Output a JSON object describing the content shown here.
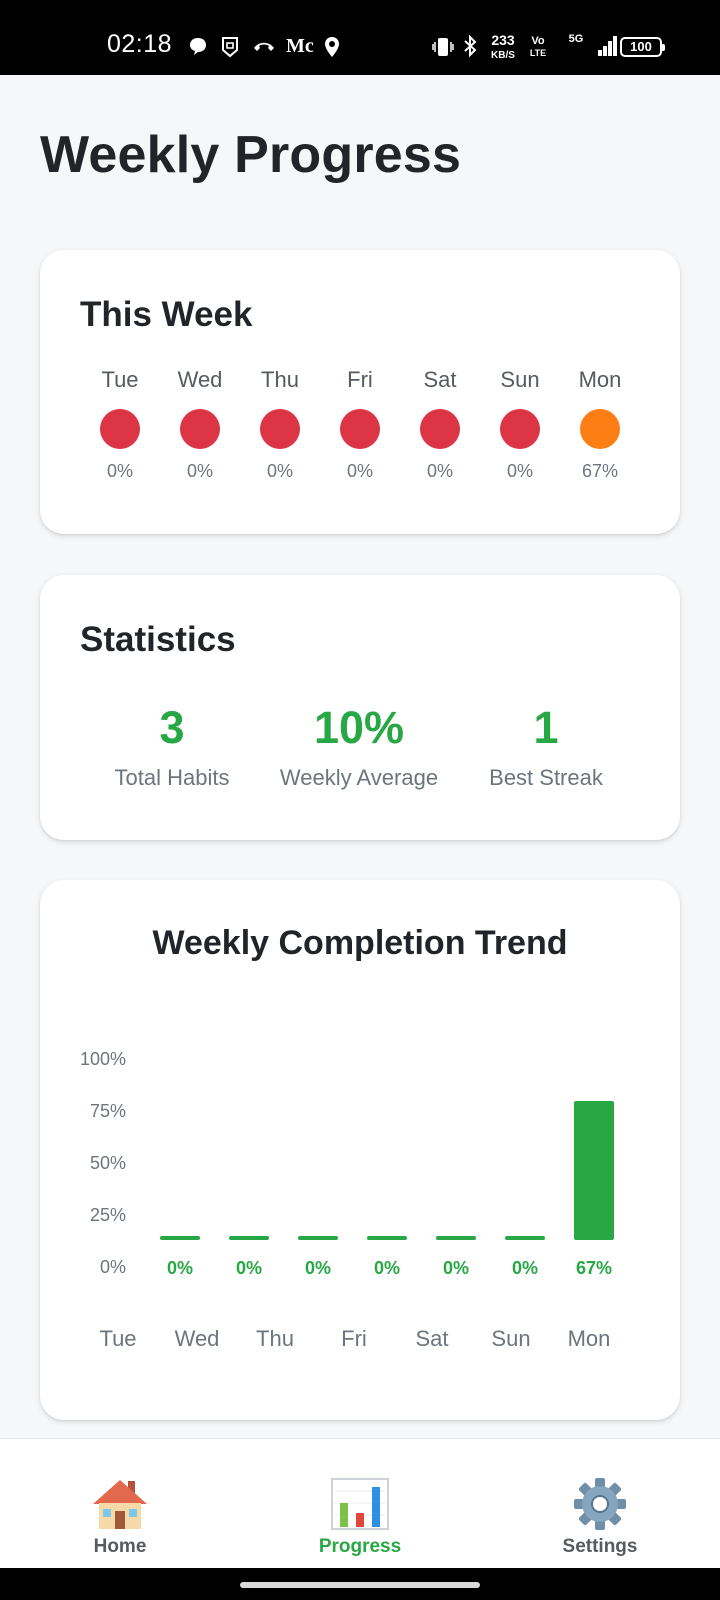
{
  "status_bar": {
    "time": "02:18",
    "network_speed_value": "233",
    "network_speed_unit": "KB/S",
    "volte_top": "Vo",
    "volte_bottom": "LTE",
    "network_type": "5G",
    "battery": "100",
    "carrier_text": "Mc"
  },
  "page": {
    "title": "Weekly Progress"
  },
  "this_week": {
    "title": "This Week",
    "days": [
      {
        "name": "Tue",
        "percent": "0%",
        "color": "#dc3545"
      },
      {
        "name": "Wed",
        "percent": "0%",
        "color": "#dc3545"
      },
      {
        "name": "Thu",
        "percent": "0%",
        "color": "#dc3545"
      },
      {
        "name": "Fri",
        "percent": "0%",
        "color": "#dc3545"
      },
      {
        "name": "Sat",
        "percent": "0%",
        "color": "#dc3545"
      },
      {
        "name": "Sun",
        "percent": "0%",
        "color": "#dc3545"
      },
      {
        "name": "Mon",
        "percent": "67%",
        "color": "#fd7e14"
      }
    ]
  },
  "statistics": {
    "title": "Statistics",
    "items": [
      {
        "value": "3",
        "label": "Total Habits"
      },
      {
        "value": "10%",
        "label": "Weekly Average"
      },
      {
        "value": "1",
        "label": "Best Streak"
      }
    ]
  },
  "chart_data": {
    "type": "bar",
    "title": "Weekly Completion Trend",
    "categories": [
      "Tue",
      "Wed",
      "Thu",
      "Fri",
      "Sat",
      "Sun",
      "Mon"
    ],
    "values": [
      0,
      0,
      0,
      0,
      0,
      0,
      67
    ],
    "data_labels": [
      "0%",
      "0%",
      "0%",
      "0%",
      "0%",
      "0%",
      "67%"
    ],
    "y_ticks": [
      "100%",
      "75%",
      "50%",
      "25%",
      "0%"
    ],
    "ylim": [
      0,
      100
    ],
    "bar_color": "#28a745",
    "xlabel": "",
    "ylabel": "",
    "grid": false
  },
  "bottom_nav": {
    "items": [
      {
        "label": "Home",
        "icon": "house-icon",
        "active": false
      },
      {
        "label": "Progress",
        "icon": "bar-chart-icon",
        "active": true
      },
      {
        "label": "Settings",
        "icon": "gear-icon",
        "active": false
      }
    ],
    "active_color": "#28a745"
  }
}
